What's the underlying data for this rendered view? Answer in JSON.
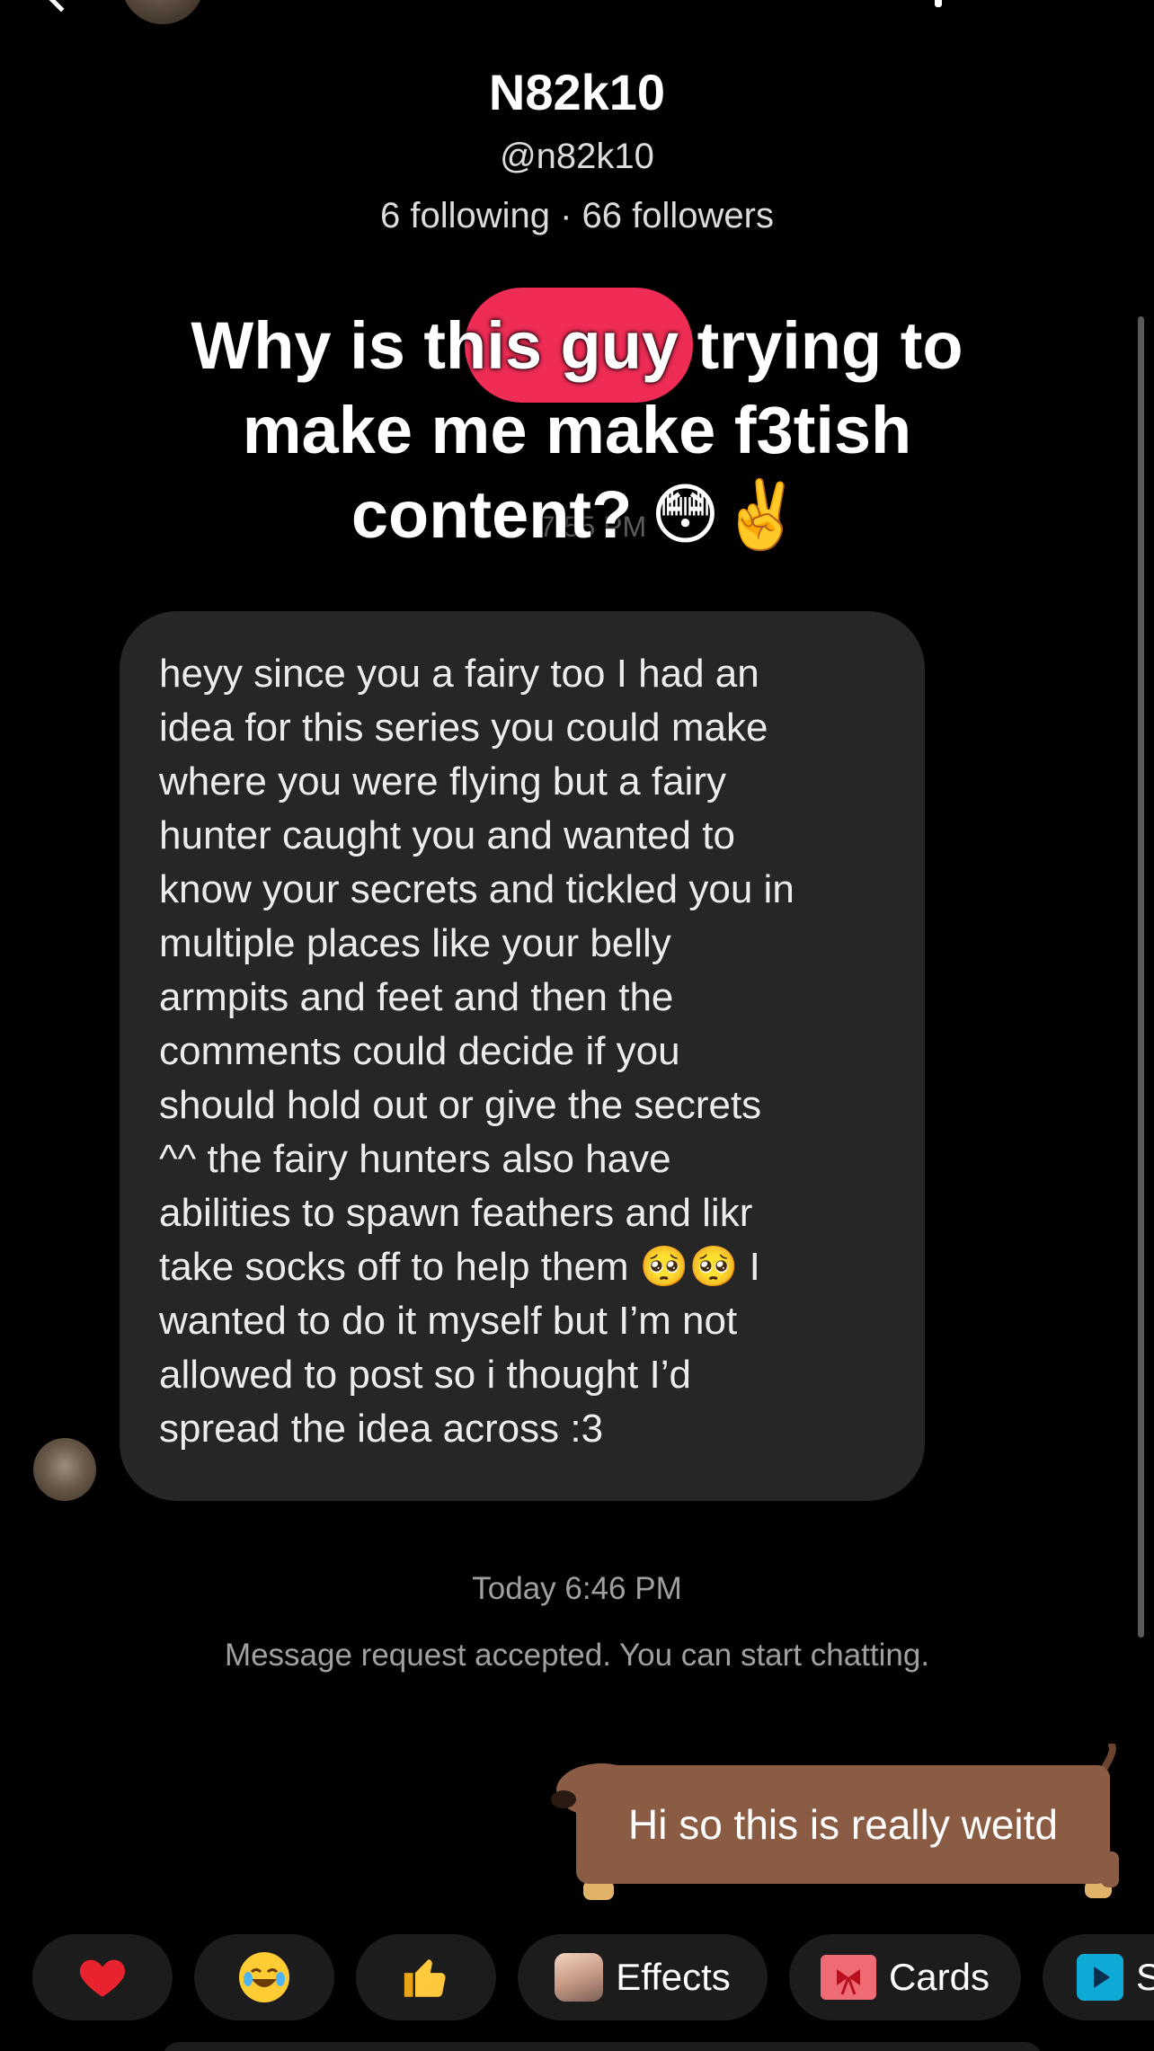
{
  "profile": {
    "name": "N82k10",
    "handle": "@n82k10",
    "stats": "6 following · 66 followers"
  },
  "overlay": {
    "caption_lines": [
      "Why is this guy trying to",
      "make me make f3tish",
      "content? 😳✌️"
    ],
    "highlight_color": "#ee2c55",
    "faint_timestamp": "7:55 PM"
  },
  "messages": {
    "incoming": {
      "text": "heyy since you a fairy too I had an\nidea for this series you could make\nwhere you were flying but a fairy\nhunter caught you and wanted to\nknow your secrets and tickled you in\nmultiple places like your belly\narmpits and feet and then the\ncomments could decide if you\nshould hold out or give the secrets\n^^ the fairy hunters also have\nabilities to spawn feathers and likr\ntake socks off to help them 🥺🥺 I\nwanted to do it myself but I’m not\nallowed to post so i thought I’d\nspread the idea across :3"
    },
    "timestamp": "Today 6:46 PM",
    "status": "Message request accepted. You can start chatting.",
    "outgoing": {
      "text": "Hi so this is really weitd",
      "bubble_color": "#8a5c43"
    }
  },
  "quick_actions": {
    "effects_label": "Effects",
    "cards_label": "Cards",
    "partial_label": "S"
  },
  "icons": [
    "back-icon",
    "heart-icon",
    "laughing-emoji-icon",
    "thumbs-up-icon",
    "effects-icon",
    "cards-icon",
    "play-icon"
  ]
}
